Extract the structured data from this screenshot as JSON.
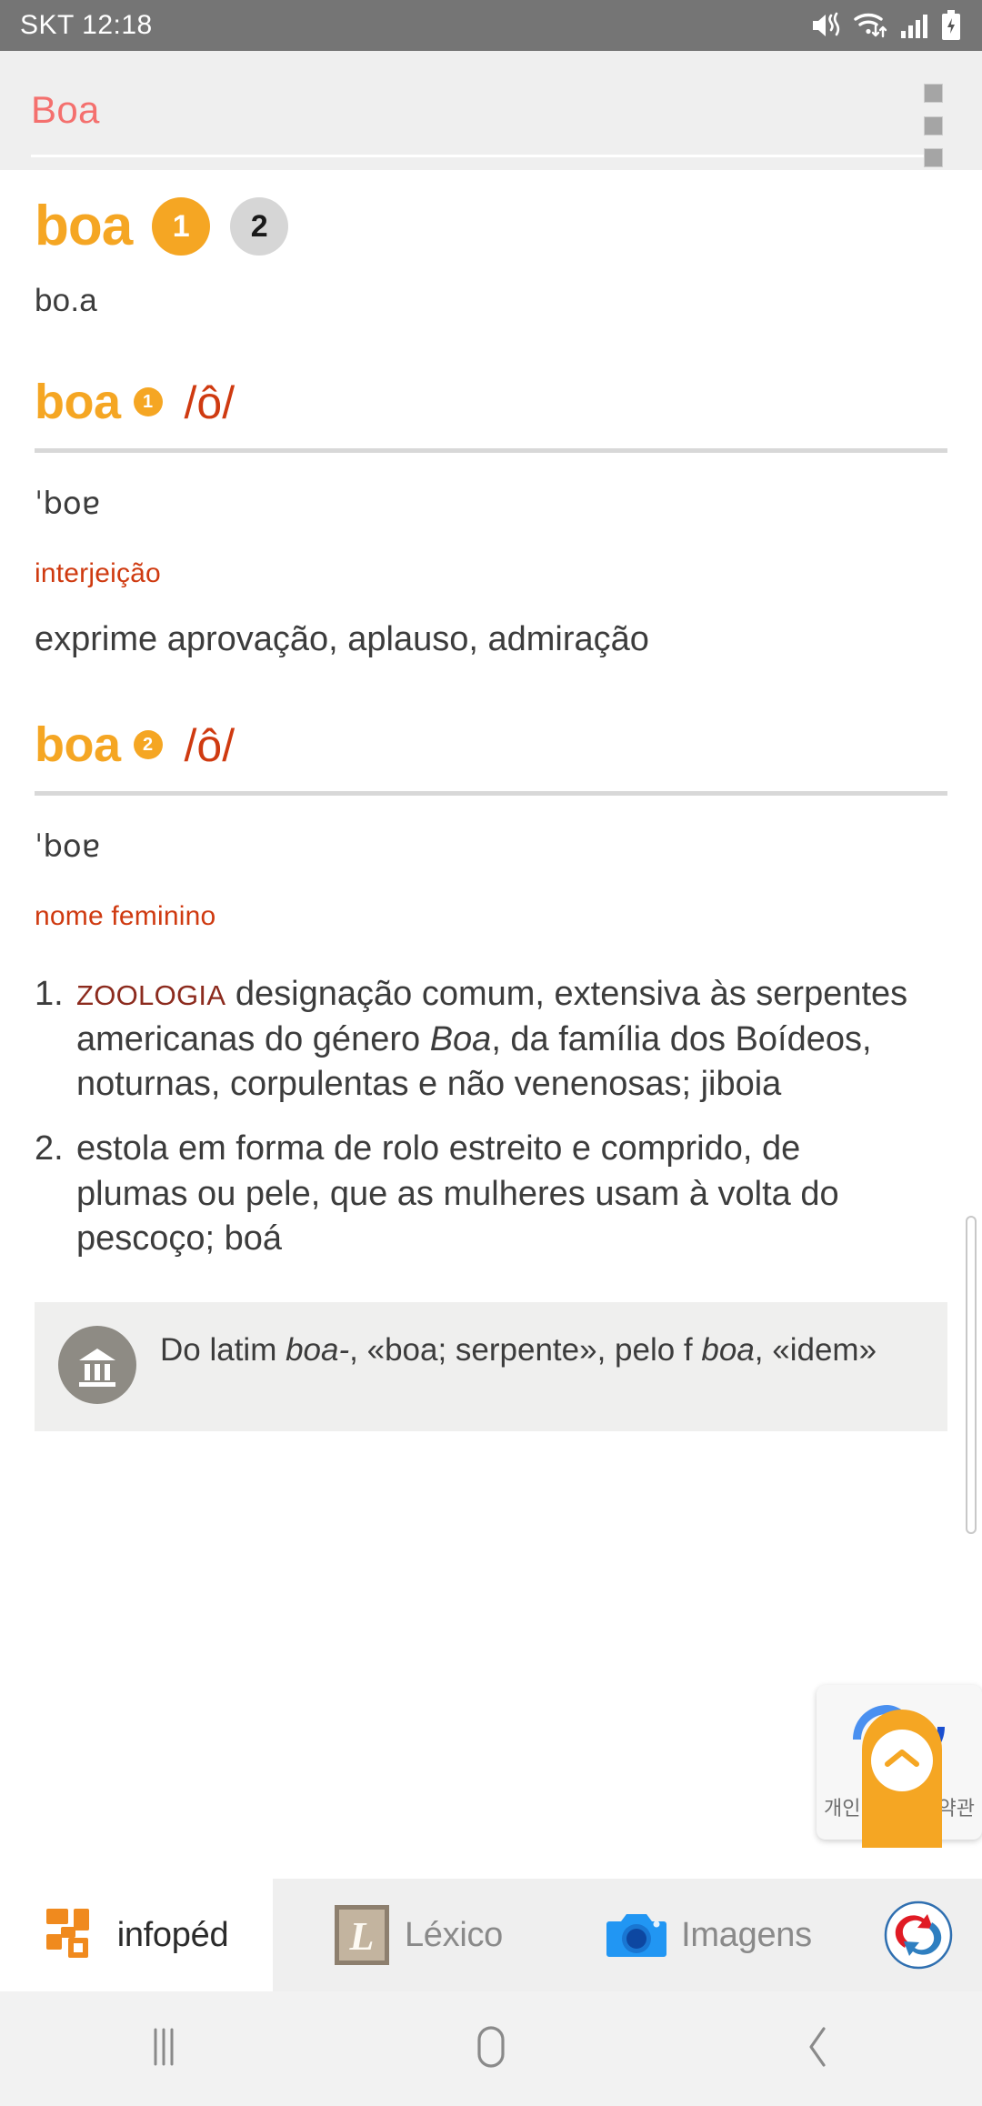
{
  "status_bar": {
    "carrier_time": "SKT 12:18",
    "icons": [
      "mute-vibrate-icon",
      "wifi-icon",
      "signal-icon",
      "battery-charging-icon"
    ]
  },
  "app_bar": {
    "title": "Boa",
    "title_color": "#f4706e",
    "overflow_label": "more-options"
  },
  "headword": {
    "word": "boa",
    "senses": [
      {
        "num": "1",
        "active": true
      },
      {
        "num": "2",
        "active": false
      }
    ],
    "syllables": "bo.a"
  },
  "entries": [
    {
      "word": "boa",
      "badge": "1",
      "phonetic": "/ô/",
      "ipa": "ˈboɐ",
      "pos": "interjeição",
      "sense_text": "exprime aprovação, aplauso, admiração",
      "definitions": []
    },
    {
      "word": "boa",
      "badge": "2",
      "phonetic": "/ô/",
      "ipa": "ˈboɐ",
      "pos": "nome feminino",
      "sense_text": "",
      "definitions": [
        {
          "num": "1.",
          "domain": "ZOOLOGIA",
          "text_before_italic": " designação comum, extensiva às serpentes americanas do género ",
          "italic": "Boa",
          "text_after_italic": ", da família dos Boídeos, noturnas, corpulentas e não venenosas; jiboia"
        },
        {
          "num": "2.",
          "domain": "",
          "text_before_italic": "estola em forma de rolo estreito e comprido, de plumas ou pele, que as mulheres usam à volta do pescoço; boá",
          "italic": "",
          "text_after_italic": ""
        }
      ]
    }
  ],
  "etymology": {
    "icon": "classical-column-icon",
    "line1_prefix": "Do latim ",
    "line1_italic": "boa-",
    "line1_suffix": ", «boa; serpente», pelo f",
    "line2_italic": "boa",
    "line2_suffix": ", «idem»"
  },
  "overlay": {
    "sync_icon": "sync-arrows-icon",
    "left_label": "개인",
    "right_label": "약관",
    "fab_icon": "chevron-up-icon",
    "fab_color": "#f5a623"
  },
  "tab_bar": {
    "tabs": [
      {
        "label": "infopéd",
        "icon": "infopedia-logo-icon",
        "active": true
      },
      {
        "label": "Léxico",
        "icon": "lexico-l-icon",
        "active": false
      },
      {
        "label": "Imagens",
        "icon": "camera-icon",
        "active": false
      },
      {
        "label": "",
        "icon": "translate-sync-icon",
        "active": false
      }
    ]
  },
  "nav_bar": {
    "buttons": [
      {
        "name": "recents-button",
        "icon": "recents-icon"
      },
      {
        "name": "home-button",
        "icon": "home-icon"
      },
      {
        "name": "back-button",
        "icon": "back-chevron-icon"
      }
    ]
  }
}
